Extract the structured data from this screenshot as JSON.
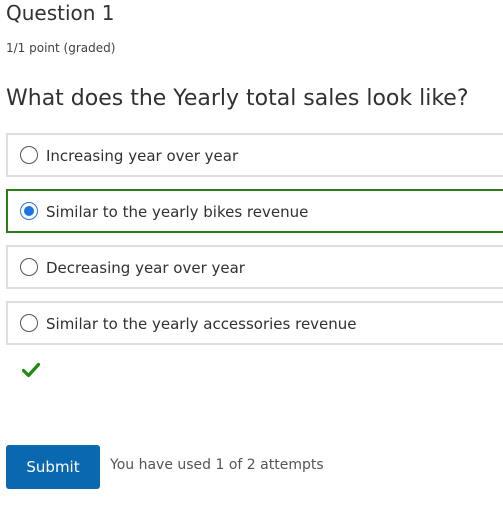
{
  "question": {
    "heading": "Question 1",
    "points": "1/1 point (graded)",
    "prompt": "What does the Yearly total sales look like?"
  },
  "choices": [
    {
      "label": "Increasing year over year",
      "selected": false
    },
    {
      "label": "Similar to the yearly bikes revenue",
      "selected": true
    },
    {
      "label": "Decreasing year over year",
      "selected": false
    },
    {
      "label": "Similar to the yearly accessories revenue",
      "selected": false
    }
  ],
  "feedback": {
    "icon": "checkmark-icon",
    "color": "#1f8a10"
  },
  "actions": {
    "submit_label": "Submit",
    "attempts_text": "You have used 1 of 2 attempts"
  },
  "colors": {
    "selected_border": "#2c7d1a",
    "radio_selected": "#1a73e8",
    "submit_bg": "#0a68b0"
  }
}
